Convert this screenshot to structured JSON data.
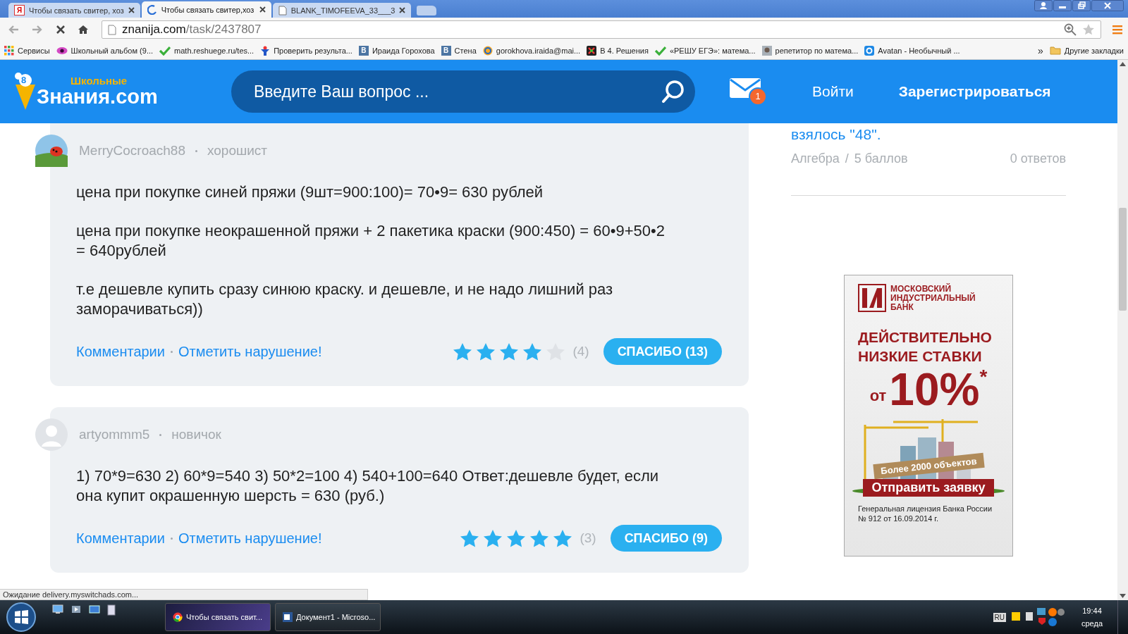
{
  "browser": {
    "tabs": [
      {
        "title": "Чтобы связать свитер, хоз",
        "kind": "yandex",
        "icon_text": "Я",
        "selected": false
      },
      {
        "title": "Чтобы связать свитер,хоз",
        "kind": "loading",
        "selected": true
      },
      {
        "title": "BLANK_TIMOFEEVA_33___3",
        "kind": "page",
        "selected": false
      }
    ],
    "address": {
      "host": "znanija.com",
      "path": "/task/2437807"
    },
    "bookmarks": [
      {
        "label": "Сервисы",
        "kind": "apps"
      },
      {
        "label": "Школьный альбом (9...",
        "kind": "eye"
      },
      {
        "label": "math.reshuege.ru/tes...",
        "kind": "check"
      },
      {
        "label": "Проверить результа...",
        "kind": "figure"
      },
      {
        "label": "Ираида Горохова",
        "kind": "letter",
        "icon_text": "B"
      },
      {
        "label": "Стена",
        "kind": "letter",
        "icon_text": "B"
      },
      {
        "label": "gorokhova.iraida@mai...",
        "kind": "at"
      },
      {
        "label": "В 4. Решения",
        "kind": "cross"
      },
      {
        "label": "«РЕШУ ЕГЭ»: матема...",
        "kind": "check"
      },
      {
        "label": "репетитор по матема...",
        "kind": "photo"
      },
      {
        "label": "Avatan - Необычный ...",
        "kind": "ring"
      }
    ],
    "more": "»",
    "other_bookmarks": "Другие закладки"
  },
  "site_header": {
    "logo_small": "Школьные",
    "logo_big": "Знания.com",
    "logo_badge": "8",
    "search_placeholder": "Введите Ваш вопрос ...",
    "mail_count": "1",
    "login": "Войти",
    "register": "Зарегистрироваться"
  },
  "answers": [
    {
      "author": "MerryCocroach88",
      "rank": "хорошист",
      "avatar": {
        "kind": "photo"
      },
      "paragraphs": [
        "цена при покупке синей пряжи (9шт=900:100)= 70•9= 630 рублей",
        "цена при покупке неокрашенной пряжи + 2 пакетика краски (900:450) = 60•9+50•2 = 640рублей",
        "т.е дешевле купить сразу синюю краску. и дешевле, и не надо лишний раз заморачиваться))"
      ],
      "comments": "Комментарии",
      "report": "Отметить нарушение!",
      "stars": 4,
      "votes": "(4)",
      "thanks": "СПАСИБО (13)"
    },
    {
      "author": "artyommm5",
      "rank": "новичок",
      "avatar": {
        "kind": "default"
      },
      "paragraphs": [
        "1) 70*9=630 2) 60*9=540 3) 50*2=100 4) 540+100=640 Ответ:дешевле будет, если она купит окрашенную шерсть = 630 (руб.)"
      ],
      "comments": "Комментарии",
      "report": "Отметить нарушение!",
      "stars": 5,
      "votes": "(3)",
      "thanks": "СПАСИБО (9)"
    }
  ],
  "sidebar": {
    "question_tail": "взялось \"48\".",
    "subject": "Алгебра",
    "separator": "/",
    "points": "5 баллов",
    "answers_count": "0 ответов",
    "ad": {
      "bank": "МОСКОВСКИЙ ИНДУСТРИАЛЬНЫЙ БАНК",
      "headline": "ДЕЙСТВИТЕЛЬНО НИЗКИЕ СТАВКИ",
      "rate_prefix": "от",
      "rate": "10%",
      "asterisk": "*",
      "objects": "Более 2000 объектов",
      "cta": "Отправить заявку",
      "license": "Генеральная лицензия Банка России № 912 от 16.09.2014 г."
    }
  },
  "status_text": "Ожидание delivery.myswitchads.com...",
  "taskbar": {
    "items": [
      {
        "label": "Чтобы связать свит...",
        "kind": "chrome",
        "selected": true
      },
      {
        "label": "Документ1 - Microso...",
        "kind": "word",
        "selected": false
      }
    ],
    "language": "RU",
    "time": "19:44",
    "day": "среда"
  }
}
